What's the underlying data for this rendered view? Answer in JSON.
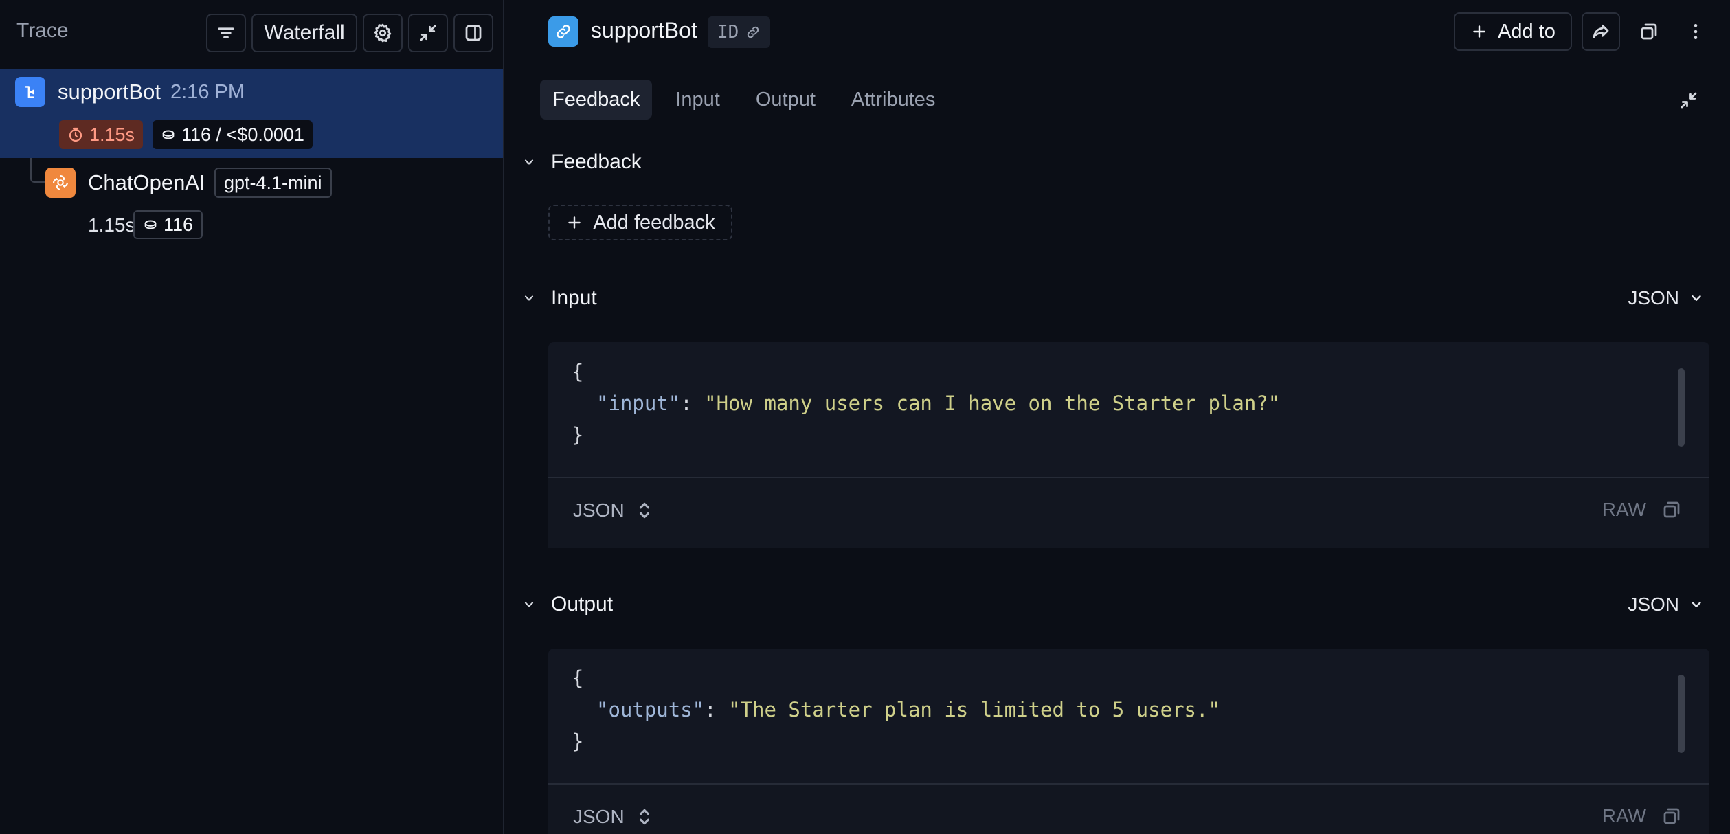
{
  "trace_panel": {
    "title": "Trace",
    "view_button_label": "Waterfall",
    "root_run": {
      "name": "supportBot",
      "time": "2:16 PM",
      "latency": "1.15s",
      "tokens_cost": "116 / <$0.0001"
    },
    "child_run": {
      "name": "ChatOpenAI",
      "model": "gpt-4.1-mini",
      "latency": "1.15s",
      "tokens": "116"
    }
  },
  "detail": {
    "title": "supportBot",
    "id_label": "ID",
    "add_to_label": "Add to",
    "tabs": [
      "Feedback",
      "Input",
      "Output",
      "Attributes"
    ],
    "active_tab": "Feedback",
    "feedback_section": {
      "label": "Feedback",
      "add_label": "Add feedback"
    },
    "input_section": {
      "label": "Input",
      "format": "JSON",
      "open_brace": "{",
      "close_brace": "}",
      "key": "\"input\"",
      "colon": ": ",
      "value": "\"How many users can I have on the Starter plan?\"",
      "footer_format": "JSON",
      "raw_label": "RAW"
    },
    "output_section": {
      "label": "Output",
      "format": "JSON",
      "open_brace": "{",
      "close_brace": "}",
      "key": "\"outputs\"",
      "colon": ": ",
      "value": "\"The Starter plan is limited to 5 users.\"",
      "footer_format": "JSON",
      "raw_label": "RAW"
    }
  },
  "colors": {
    "background": "#0b0e16",
    "selected_row": "#183061",
    "latency_badge": "#5e2a22",
    "chain_icon": "#3b82f6",
    "llm_icon": "#f0883e",
    "json_string": "#cfd08a",
    "json_key": "#9fb6d8"
  }
}
